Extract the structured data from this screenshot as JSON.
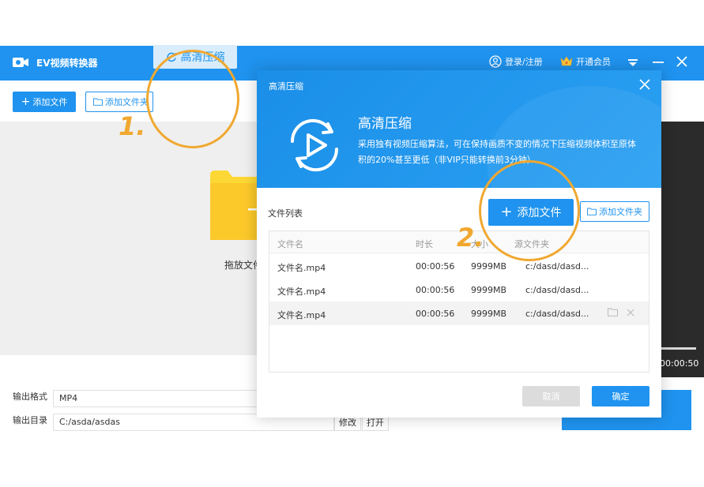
{
  "app": {
    "title": "EV视频转换器",
    "login_label": "登录/注册",
    "vip_label": "开通会员"
  },
  "toolbar": {
    "add_file": "添加文件",
    "add_folder": "添加文件夹",
    "hd_compress": "高清压缩"
  },
  "droparea": {
    "text": "拖放文件"
  },
  "preview": {
    "time": "00:00:50"
  },
  "output": {
    "format_label": "输出格式",
    "format_value": "MP4",
    "dir_label": "输出目录",
    "dir_value": "C:/asda/asdas",
    "modify_label": "修改",
    "open_label": "打开"
  },
  "dialog": {
    "title": "高清压缩",
    "heading": "高清压缩",
    "description": "采用独有视频压缩算法，可在保持画质不变的情况下压缩视频体积至原体积的20%甚至更低（非VIP只能转换前3分钟）",
    "file_list_label": "文件列表",
    "add_file": "添加文件",
    "add_folder": "添加文件夹",
    "columns": [
      "文件名",
      "时长",
      "大小",
      "源文件夹"
    ],
    "rows": [
      {
        "name": "文件名.mp4",
        "duration": "00:00:56",
        "size": "9999MB",
        "path": "c:/dasd/dasd..."
      },
      {
        "name": "文件名.mp4",
        "duration": "00:00:56",
        "size": "9999MB",
        "path": "c:/dasd/dasd..."
      },
      {
        "name": "文件名.mp4",
        "duration": "00:00:56",
        "size": "9999MB",
        "path": "c:/dasd/dasd..."
      }
    ],
    "cancel_label": "取消",
    "ok_label": "确定"
  },
  "annotations": {
    "step1": "1.",
    "step2": "2.",
    "ring_color": "#f0a830"
  },
  "colors": {
    "accent": "#1f93ef",
    "dialog_header": "#2aa0f2",
    "folder_yellow": "#fdd835"
  },
  "icons": {
    "app_logo": "camera-icon",
    "login": "user-circle-icon",
    "vip": "crown-icon",
    "compress": "refresh-icon",
    "folder": "folder-icon",
    "add": "plus-icon",
    "close": "close-icon",
    "delete": "close-icon",
    "minimize": "minimize-icon",
    "menu": "chevron-down-icon"
  }
}
